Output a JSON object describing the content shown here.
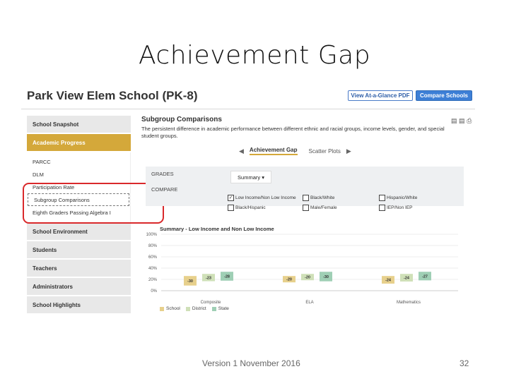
{
  "slide": {
    "title": "Achievement Gap",
    "footer_version": "Version 1   November 2016",
    "page_number": "32"
  },
  "header": {
    "school_name": "Park View Elem School (PK-8)",
    "pdf_button": "View At-a-Glance PDF",
    "compare_button": "Compare Schools"
  },
  "sidebar": {
    "groups": [
      {
        "label": "School Snapshot"
      },
      {
        "label": "Academic Progress"
      },
      {
        "label": "School Environment"
      },
      {
        "label": "Students"
      },
      {
        "label": "Teachers"
      },
      {
        "label": "Administrators"
      },
      {
        "label": "School Highlights"
      }
    ],
    "sub_items": [
      {
        "label": "PARCC"
      },
      {
        "label": "DLM"
      },
      {
        "label": "Participation Rate"
      },
      {
        "label": "Subgroup Comparisons"
      },
      {
        "label": "Eighth Graders Passing Algebra I"
      }
    ]
  },
  "main": {
    "section_title": "Subgroup Comparisons",
    "section_desc": "The persistent difference in academic performance between different ethnic and racial groups, income levels, gender, and special student groups.",
    "tabs": [
      {
        "label": "Achievement Gap"
      },
      {
        "label": "Scatter Plots"
      }
    ],
    "grades_label": "GRADES",
    "grades_value": "Summary ▾",
    "compare_label": "COMPARE",
    "compare_options": [
      {
        "label": "Low Income/Non Low Income",
        "checked": true
      },
      {
        "label": "Black/White",
        "checked": false
      },
      {
        "label": "Hispanic/White",
        "checked": false
      },
      {
        "label": "Black/Hispanic",
        "checked": false
      },
      {
        "label": "Male/Female",
        "checked": false
      },
      {
        "label": "IEP/Non IEP",
        "checked": false
      }
    ]
  },
  "chart_data": {
    "type": "bar",
    "title": "Summary - Low Income and Non Low Income",
    "y_ticks": [
      "100%",
      "80%",
      "60%",
      "40%",
      "20%",
      "0%"
    ],
    "ylim": [
      0,
      100
    ],
    "categories": [
      "Composite",
      "ELA",
      "Mathematics"
    ],
    "series": [
      {
        "name": "School",
        "color": "#e7d08c",
        "gaps": [
          -30,
          -20,
          -24
        ]
      },
      {
        "name": "District",
        "color": "#cfe0b8",
        "gaps": [
          -23,
          -20,
          -24
        ]
      },
      {
        "name": "State",
        "color": "#9fcfb5",
        "gaps": [
          -28,
          -30,
          -27
        ]
      }
    ],
    "legend": [
      "School",
      "District",
      "State"
    ]
  }
}
